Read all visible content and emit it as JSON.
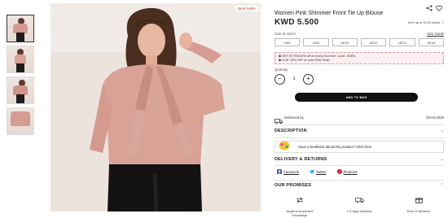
{
  "gallery": {
    "thumbnails": [
      {
        "label": "thumb-1",
        "active": true
      },
      {
        "label": "thumb-2",
        "active": false
      },
      {
        "label": "thumb-3",
        "active": false
      },
      {
        "label": "thumb-4",
        "active": false
      }
    ],
    "badge": "Best Seller"
  },
  "product": {
    "title": "Women Pink Shimmer Front Tie Up Blouse",
    "price": "KWD 5.500",
    "delivery_note": "Earn up to 16.50 points ⓘ",
    "size_label": "Size (6 sizes)",
    "size_guide": "Size Guide",
    "sizes": [
      "UK6",
      "UK8",
      "UK10",
      "UK12",
      "UK14",
      "UK16"
    ],
    "offers": [
      "GET EXTRA 50% off on every 2nd item. Code: 2GEB",
      "FLAT 15% OFF on your First Order"
    ],
    "quantity_label": "Quantity",
    "quantity": "1",
    "add_to_bag": "ADD TO BAG",
    "delivered_by": "Delivered by",
    "delivery_date": "28-03-2025"
  },
  "sections": {
    "description": "DESCRIPTION",
    "feedback": "Have a feedback about this product? Click here",
    "delivery_returns": "DELIVERY & RETURNS",
    "share": [
      "Facebook",
      "Twitter",
      "Pinterest"
    ],
    "promises_title": "OUR PROMISES",
    "promises": [
      {
        "text": "Anytime Anywhere Exchange",
        "icon": "exchange-icon"
      },
      {
        "text": "2-3 days Delivery",
        "icon": "truck-icon"
      },
      {
        "text": "Earn & Redeem",
        "icon": "gift-icon"
      }
    ]
  },
  "colors": {
    "accent": "#111111",
    "offer_bg": "#fdeef0",
    "offer_border": "#e59aa6",
    "badge_text": "#c0392b"
  }
}
